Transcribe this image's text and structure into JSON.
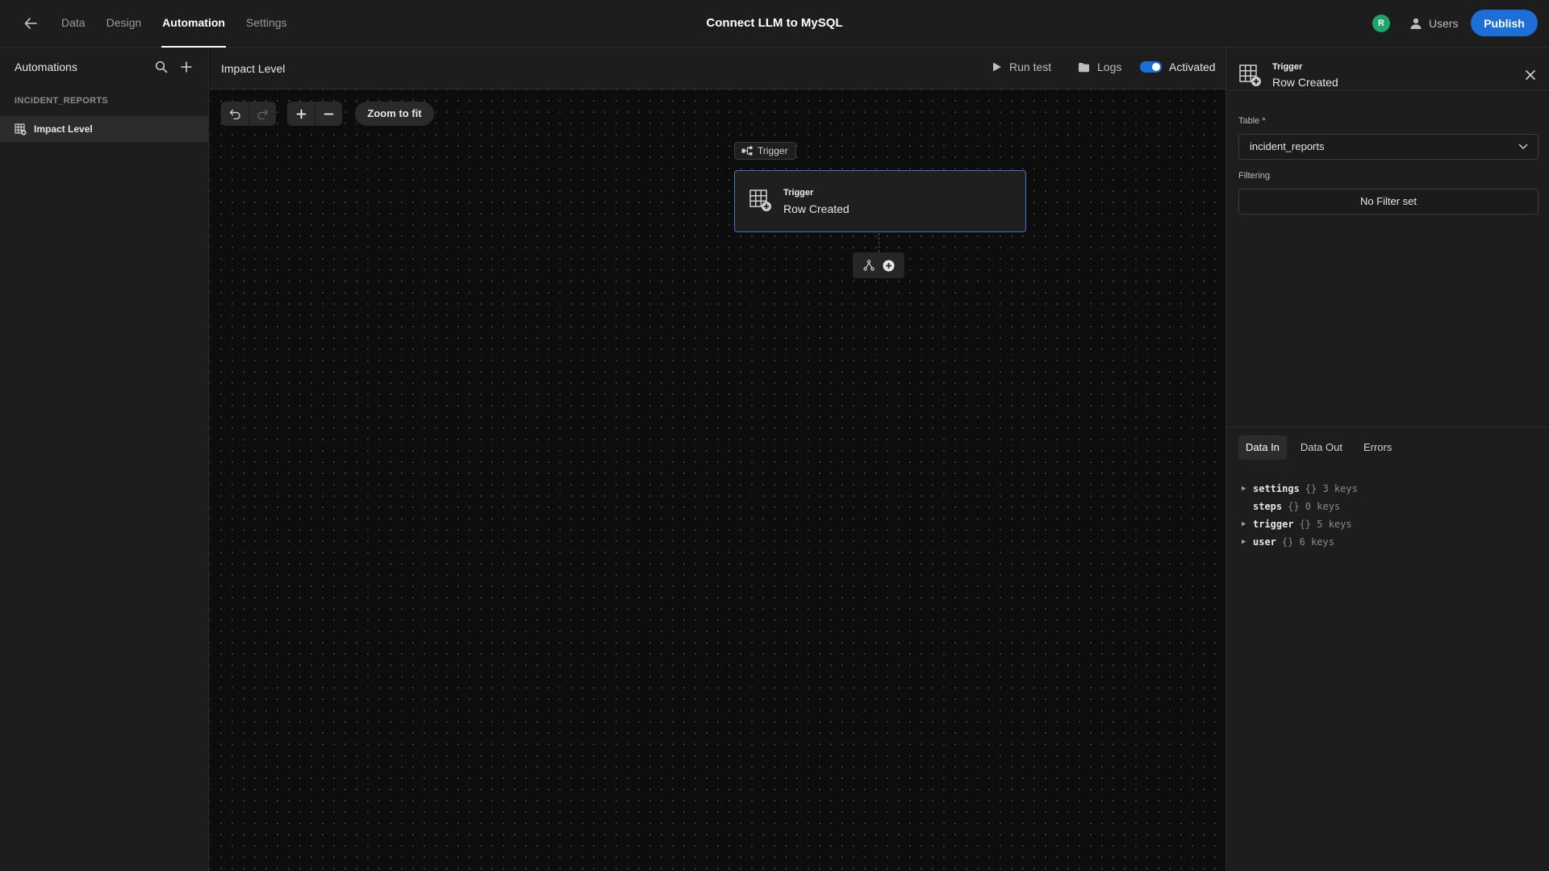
{
  "topbar": {
    "tabs": [
      {
        "label": "Data",
        "active": false
      },
      {
        "label": "Design",
        "active": false
      },
      {
        "label": "Automation",
        "active": true
      },
      {
        "label": "Settings",
        "active": false
      }
    ],
    "app_title": "Connect LLM to MySQL",
    "avatar_initial": "R",
    "avatar_color": "#1fa46c",
    "users_label": "Users",
    "publish_label": "Publish",
    "accent_color": "#1e6ed8"
  },
  "sidebar": {
    "header": "Automations",
    "group": "INCIDENT_REPORTS",
    "items": [
      {
        "label": "Impact Level",
        "icon": "table-add-icon",
        "selected": true
      }
    ]
  },
  "canvas_header": {
    "title": "Impact Level",
    "run_test_label": "Run test",
    "logs_label": "Logs",
    "activated_label": "Activated",
    "activated": true
  },
  "canvas": {
    "zoom_to_fit_label": "Zoom to fit",
    "trigger_pill_label": "Trigger",
    "node": {
      "title": "Trigger",
      "subtitle": "Row Created"
    }
  },
  "panel": {
    "title": "Trigger",
    "subtitle": "Row Created",
    "table_label": "Table *",
    "table_value": "incident_reports",
    "filtering_label": "Filtering",
    "filter_value": "No Filter set",
    "tabs": [
      {
        "label": "Data In",
        "active": true
      },
      {
        "label": "Data Out",
        "active": false
      },
      {
        "label": "Errors",
        "active": false
      }
    ],
    "tree": [
      {
        "key": "settings",
        "meta": "{} 3 keys",
        "expandable": true
      },
      {
        "key": "steps",
        "meta": "{} 0 keys",
        "expandable": false
      },
      {
        "key": "trigger",
        "meta": "{} 5 keys",
        "expandable": true
      },
      {
        "key": "user",
        "meta": "{} 6 keys",
        "expandable": true
      }
    ]
  }
}
